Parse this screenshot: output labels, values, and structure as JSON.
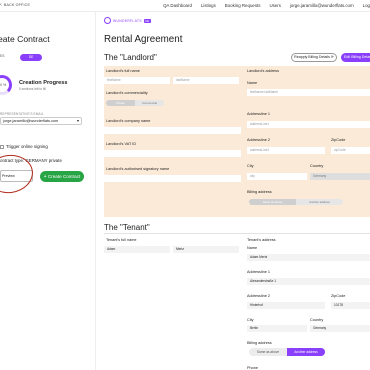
{
  "topbar": {
    "back_label": "BACK OFFICE",
    "nav": [
      "QA Dashboard",
      "Listings",
      "Booking Requests",
      "Users",
      "jorge.jaramillo@wunderflats.com",
      "Log"
    ]
  },
  "left": {
    "title": "eate Contract",
    "toggle_off": "ES",
    "toggle_on": "DE",
    "progress_value": "0 %",
    "progress_title": "Creation Progress",
    "progress_sub": "5 sections left to fill",
    "rep_label": "REPRESENTATIVE'S EMAIL",
    "rep_email": "jorge.jaramillo@wunderflats.com",
    "trigger_label": "Trigger online signing",
    "contract_type_label": "ontract type: GERMANY private",
    "preview_label": "Preview",
    "create_label": "Create Contract"
  },
  "main": {
    "logo_text": "WUNDERFLATS",
    "logo_badge": "DE",
    "title": "Rental Agreement",
    "landlord_heading": "The \"Landlord\"",
    "btn_reapply": "Reapply Billing Details",
    "btn_edit": "Edit Billing Details",
    "landlord": {
      "full_name_label": "Landlord's full name",
      "first_name_ph": "firstName",
      "last_name_ph": "lastName",
      "commerciality_label": "Landlord's commerciality",
      "commerciality_opts": [
        "Private",
        "Commercial"
      ],
      "company_label": "Landlord's company name",
      "vat_label": "Landlord's VAT ID",
      "signatory_label": "Landlord's authorised signatory name",
      "address_label": "Landlord's address",
      "name_label": "Name",
      "name_ph": "firstName lastName",
      "addr1_label": "Addressline 1",
      "addr1_ph": "addressLine1",
      "addr2_label": "Addressline 2",
      "addr2_ph": "addressLine2",
      "zip_label": "ZipCode",
      "zip_ph": "zipCode",
      "city_label": "City",
      "city_ph": "city",
      "country_label": "Country",
      "country_value": "Germany",
      "billing_label": "Billing address",
      "billing_opts": [
        "Same as above",
        "Another address"
      ]
    },
    "tenant_heading": "The \"Tenant\"",
    "tenant": {
      "full_name_label": "Tenant's full name",
      "first_name": "Adam",
      "last_name": "Mertz",
      "address_label": "Tenant's address",
      "name_label": "Name",
      "name_value": "Adam Mertz",
      "addr1_label": "Addressline 1",
      "addr1_value": "Alexanderstraße 1",
      "addr2_label": "Addressline 2",
      "addr2_value": "Hinterhof",
      "zip_label": "ZipCode",
      "zip_value": "10178",
      "city_label": "City",
      "city_value": "Berlin",
      "country_label": "Country",
      "country_value": "Germany",
      "billing_label": "Billing address",
      "billing_opts": [
        "Same as above",
        "Another address"
      ],
      "next_label": "Phone"
    }
  }
}
